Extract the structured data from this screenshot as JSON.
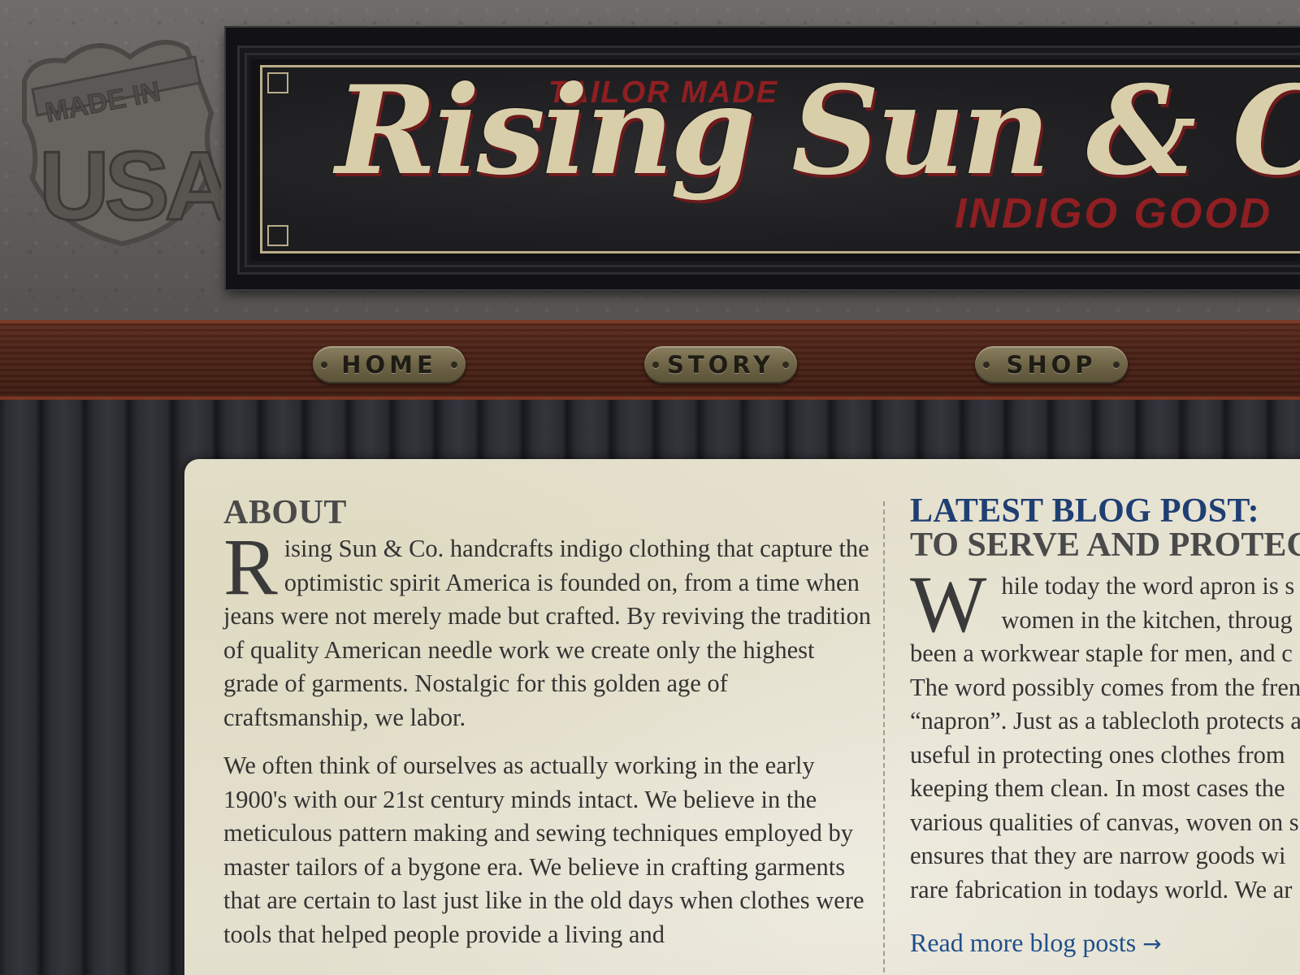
{
  "header": {
    "badge_top": "MADE IN",
    "badge_bottom": "USA",
    "sign_top_tagline": "TAILOR MADE",
    "sign_brand": "Rising Sun & C",
    "sign_bottom_tagline": "INDIGO GOOD"
  },
  "nav": {
    "items": [
      {
        "label": "HOME"
      },
      {
        "label": "STORY"
      },
      {
        "label": "SHOP"
      }
    ]
  },
  "about": {
    "heading": "ABOUT",
    "dropcap": "R",
    "paragraph1": "ising Sun & Co. handcrafts indigo clothing that capture the optimistic spirit America is founded on, from a time when jeans were not merely made but crafted. By reviving the tradition of quality American needle work we create only the highest grade of garments. Nostalgic for this golden age of craftsmanship, we labor.",
    "paragraph2": "We often think of ourselves as actually working in the early 1900's with our 21st century minds intact. We believe in the meticulous pattern making and sewing techniques employed by master tailors of a bygone era. We believe in crafting garments that are certain to last just like in the old days when clothes were tools that helped people provide a living and"
  },
  "blog": {
    "heading": "LATEST BLOG POST:",
    "title": "TO SERVE AND PROTEC",
    "dropcap": "W",
    "lines": [
      "hile today the word apron is s",
      "women in the kitchen, throug",
      "been a workwear staple for men, and c",
      "The word possibly comes from the fren",
      "“napron”. Just as a tablecloth protects a",
      "useful in protecting ones clothes from",
      "keeping them clean. In  most cases the",
      "various qualities of canvas, woven on s",
      "ensures that they are narrow goods wi",
      "rare fabrication in todays world. We ar"
    ],
    "read_more": "Read more blog posts",
    "read_more_arrow": "→"
  },
  "colors": {
    "blog_heading": "#1f3f73",
    "link": "#1f4f8a",
    "sign_red": "#8f1f22",
    "sign_cream": "#d9ceaa",
    "wood": "#4a2216"
  }
}
